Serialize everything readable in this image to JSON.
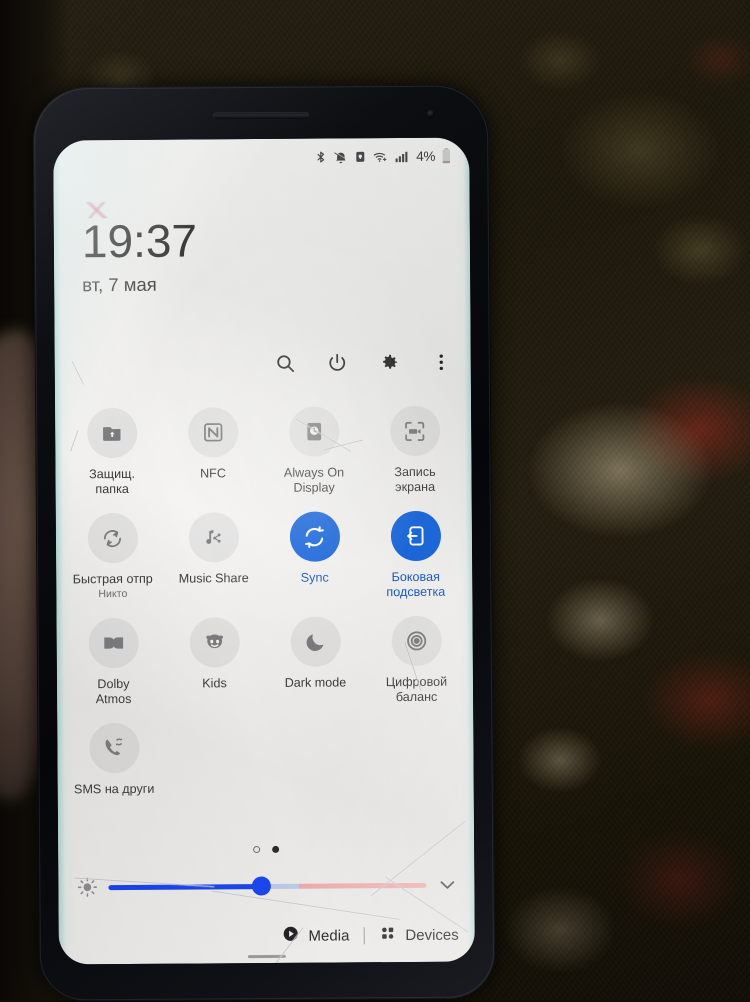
{
  "device": {
    "screen_label": "samsung-galaxy-quick-settings-panel"
  },
  "status_bar": {
    "icons": [
      "bluetooth-icon",
      "mute-bell-icon",
      "secure-lock-icon",
      "wifi-plus-icon",
      "signal-bars-icon"
    ],
    "battery_percent": "4%",
    "battery_icon": "battery-low-icon"
  },
  "lockscreen": {
    "time": "19:37",
    "date": "вт, 7 мая"
  },
  "actions": [
    {
      "name": "search-icon",
      "label": "Search"
    },
    {
      "name": "power-icon",
      "label": "Power"
    },
    {
      "name": "gear-icon",
      "label": "Settings"
    },
    {
      "name": "more-vertical-icon",
      "label": "More options"
    }
  ],
  "tiles": [
    {
      "label": "Защищ.\nпапка",
      "icon": "secure-folder-icon",
      "active": false,
      "sub": ""
    },
    {
      "label": "NFC",
      "icon": "nfc-icon",
      "active": false,
      "sub": ""
    },
    {
      "label": "Always On\nDisplay",
      "icon": "always-on-display-icon",
      "active": false,
      "sub": ""
    },
    {
      "label": "Запись\nэкрана",
      "icon": "screen-record-icon",
      "active": false,
      "sub": ""
    },
    {
      "label": "Быстрая отпр",
      "icon": "quick-share-icon",
      "active": false,
      "sub": "Никто"
    },
    {
      "label": "Music Share",
      "icon": "music-share-icon",
      "active": false,
      "sub": ""
    },
    {
      "label": "Sync",
      "icon": "sync-icon",
      "active": true,
      "sub": ""
    },
    {
      "label": "Боковая\nподсветка",
      "icon": "edge-lighting-icon",
      "active": true,
      "sub": ""
    },
    {
      "label": "Dolby\nAtmos",
      "icon": "dolby-atmos-icon",
      "active": false,
      "sub": ""
    },
    {
      "label": "Kids",
      "icon": "kids-mode-icon",
      "active": false,
      "sub": ""
    },
    {
      "label": "Dark mode",
      "icon": "dark-mode-icon",
      "active": false,
      "sub": ""
    },
    {
      "label": "Цифровой\nбаланс",
      "icon": "digital-wellbeing-icon",
      "active": false,
      "sub": ""
    },
    {
      "label": "SMS на други",
      "icon": "sms-other-device-icon",
      "active": false,
      "sub": ""
    }
  ],
  "pager": {
    "total_pages": 2,
    "active_page": 2
  },
  "brightness": {
    "icon": "brightness-icon",
    "value_percent": 48,
    "expand_icon": "chevron-down-icon"
  },
  "bottom_bar": {
    "media_label": "Media",
    "media_icon": "play-circle-icon",
    "devices_label": "Devices",
    "devices_icon": "devices-grid-icon"
  },
  "colors": {
    "accent_blue": "#1464dc",
    "slider_blue": "#1a46ec",
    "slider_warm": "#e9a9a8",
    "tile_inactive": "#7b7b7e"
  }
}
